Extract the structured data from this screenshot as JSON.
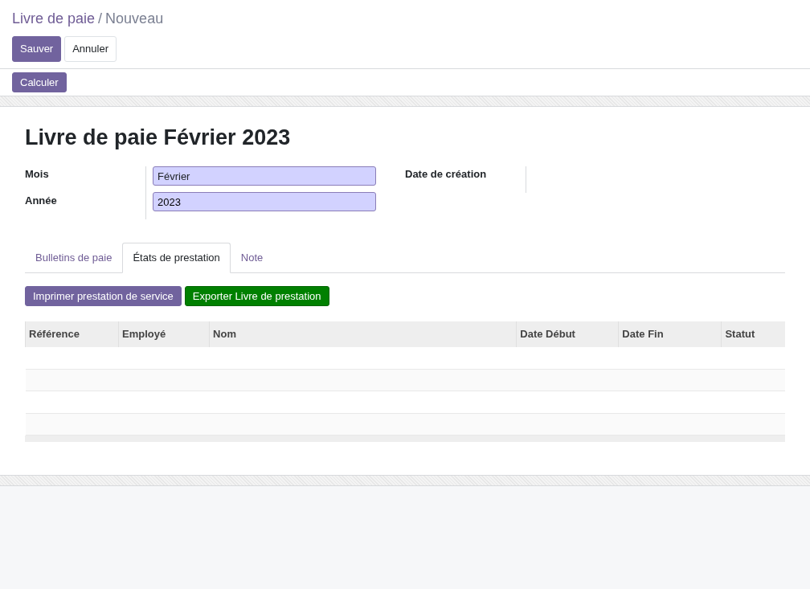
{
  "breadcrumb": {
    "parent": "Livre de paie",
    "separator": "/",
    "current": "Nouveau"
  },
  "actions": [
    "Sauver",
    "Annuler"
  ],
  "header_buttons": [
    "Calculer"
  ],
  "form": {
    "title": "Livre de paie Février 2023",
    "fields": [
      {
        "label": "Mois",
        "kind": "select",
        "value": "Février"
      },
      {
        "label": "Année",
        "kind": "input",
        "value": "2023"
      }
    ],
    "side_fields": [
      {
        "label": "Date de création"
      }
    ]
  },
  "tabs": [
    {
      "label": "Bulletins de paie",
      "selected": false
    },
    {
      "label": "États de prestation",
      "selected": true
    },
    {
      "label": "Note",
      "selected": false
    }
  ],
  "tab_buttons": [
    {
      "label": "Imprimer prestation de service",
      "kind": "primary"
    },
    {
      "label": "Exporter Livre de prestation",
      "kind": "success"
    }
  ],
  "table": {
    "columns": [
      "Référence",
      "Employé",
      "Nom",
      "Date Début",
      "Date Fin",
      "Statut"
    ]
  }
}
